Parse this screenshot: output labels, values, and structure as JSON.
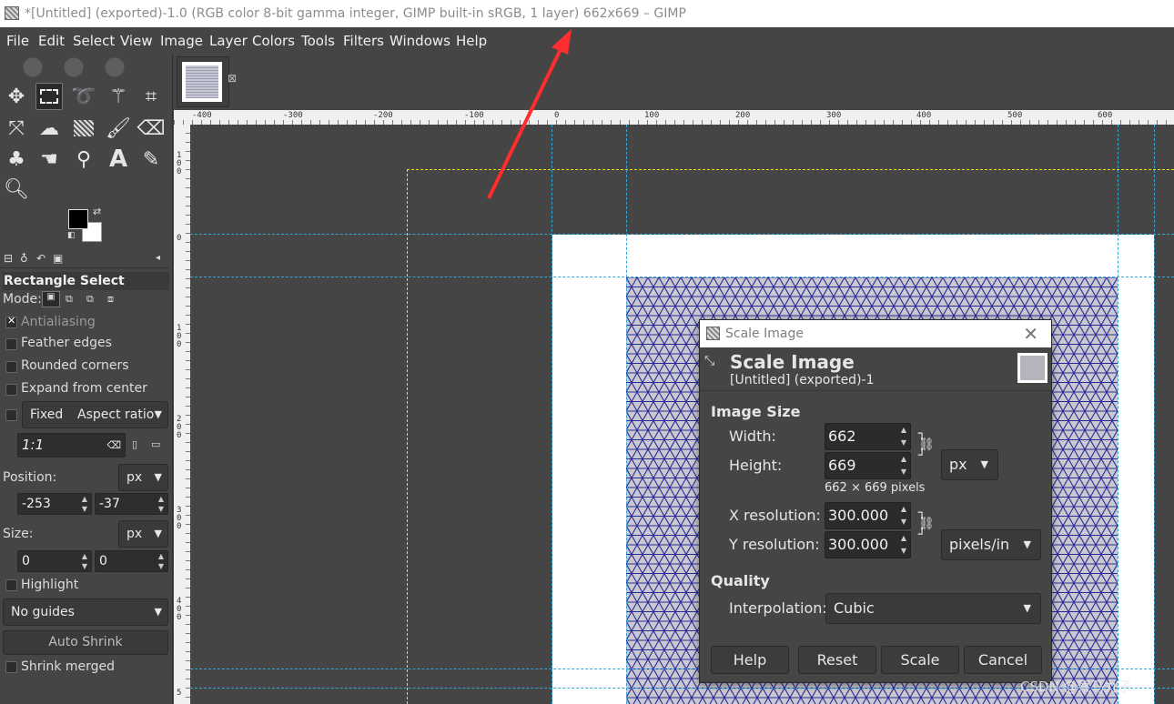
{
  "window": {
    "title": "*[Untitled] (exported)-1.0 (RGB color 8-bit gamma integer, GIMP built-in sRGB, 1 layer) 662x669 – GIMP"
  },
  "menu": [
    "File",
    "Edit",
    "Select",
    "View",
    "Image",
    "Layer",
    "Colors",
    "Tools",
    "Filters",
    "Windows",
    "Help"
  ],
  "tools": [
    "move-tool-icon",
    "rect-select-icon",
    "lasso-icon",
    "fuzzy-select-icon",
    "crop-icon",
    "transform-icon",
    "warp-icon",
    "gradient-icon",
    "paintbrush-icon",
    "eraser-icon",
    "clone-icon",
    "smudge-icon",
    "path-icon",
    "text-icon",
    "color-picker-icon",
    "zoom-icon"
  ],
  "tool_options": {
    "title": "Rectangle Select",
    "mode_label": "Mode:",
    "antialiasing": "Antialiasing",
    "feather_edges": "Feather edges",
    "rounded_corners": "Rounded corners",
    "expand_from_center": "Expand from center",
    "fixed": "Fixed",
    "aspect_ratio": "Aspect ratio",
    "ratio_value": "1:1",
    "position_label": "Position:",
    "position_unit": "px",
    "position_x": "-253",
    "position_y": "-37",
    "size_label": "Size:",
    "size_unit": "px",
    "size_w": "0",
    "size_h": "0",
    "highlight": "Highlight",
    "guides": "No guides",
    "auto_shrink": "Auto Shrink",
    "shrink_merged": "Shrink merged"
  },
  "ruler": {
    "h_labels": [
      "-400",
      "-300",
      "-200",
      "-100",
      "0",
      "100",
      "200",
      "300",
      "400",
      "500",
      "600"
    ],
    "v_labels": [
      "100",
      "0",
      "100",
      "200",
      "300",
      "400",
      "5"
    ]
  },
  "dialog": {
    "window_title": "Scale Image",
    "heading": "Scale Image",
    "subtitle": "[Untitled] (exported)-1",
    "image_size": "Image Size",
    "width_label": "Width:",
    "width_value": "662",
    "height_label": "Height:",
    "height_value": "669",
    "size_unit": "px",
    "pixels_info": "662 × 669 pixels",
    "xres_label": "X resolution:",
    "xres_value": "300.000",
    "yres_label": "Y resolution:",
    "yres_value": "300.000",
    "res_unit": "pixels/in",
    "quality": "Quality",
    "interp_label": "Interpolation:",
    "interp_value": "Cubic",
    "help": "Help",
    "reset": "Reset",
    "scale": "Scale",
    "cancel": "Cancel"
  },
  "watermark": "CSDN @察马丸子",
  "colors": {
    "accent": "#ff2d2d",
    "guide": "#2fa8d8",
    "selection": "#e6e600",
    "mesh": "#2a2a9a"
  }
}
